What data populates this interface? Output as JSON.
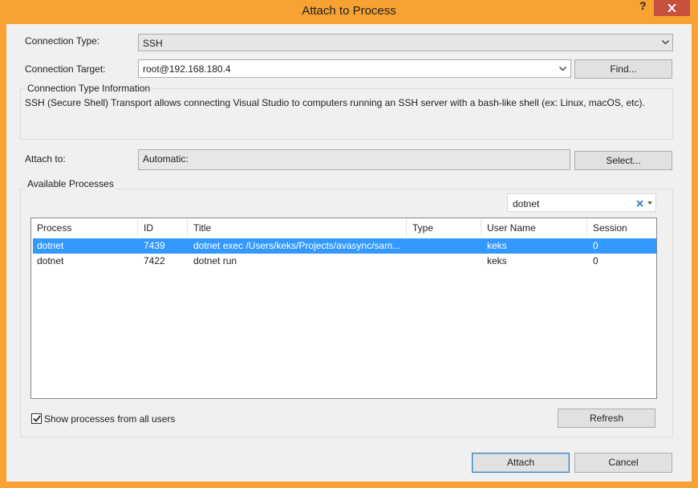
{
  "dialog": {
    "title": "Attach to Process",
    "help_glyph": "?"
  },
  "connection_type": {
    "label": "Connection Type:",
    "value": "SSH"
  },
  "connection_target": {
    "label": "Connection Target:",
    "value": "root@192.168.180.4",
    "find_label": "Find..."
  },
  "info": {
    "title": "Connection Type Information",
    "text": "SSH (Secure Shell) Transport allows connecting Visual Studio to computers running an SSH server with a bash-like shell (ex: Linux, macOS, etc)."
  },
  "attach_to": {
    "label": "Attach to:",
    "value": "Automatic:",
    "select_label": "Select..."
  },
  "available": {
    "title": "Available Processes",
    "filter_value": "dotnet",
    "columns": [
      "Process",
      "ID",
      "Title",
      "Type",
      "User Name",
      "Session"
    ],
    "rows": [
      {
        "process": "dotnet",
        "id": "7439",
        "title": "dotnet exec /Users/keks/Projects/avasync/sam...",
        "type": "",
        "user": "keks",
        "session": "0",
        "selected": true
      },
      {
        "process": "dotnet",
        "id": "7422",
        "title": "dotnet run",
        "type": "",
        "user": "keks",
        "session": "0",
        "selected": false
      }
    ],
    "show_all_label": "Show processes from all users",
    "show_all_checked": true,
    "refresh_label": "Refresh"
  },
  "footer": {
    "attach_label": "Attach",
    "cancel_label": "Cancel"
  },
  "colors": {
    "frame": "#f7a233",
    "close": "#c7503f",
    "selection": "#3399ff",
    "accent_x": "#1e73c8"
  }
}
